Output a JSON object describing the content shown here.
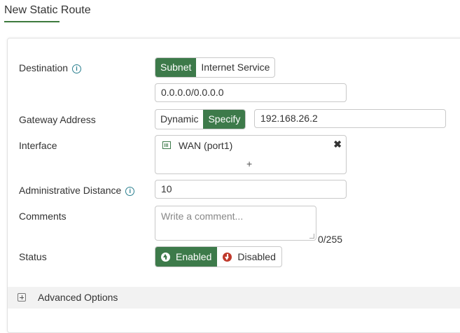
{
  "page": {
    "title": "New Static Route"
  },
  "form": {
    "destination": {
      "label": "Destination",
      "options": [
        "Subnet",
        "Internet Service"
      ],
      "selected": "Subnet",
      "value": "0.0.0.0/0.0.0.0"
    },
    "gateway": {
      "label": "Gateway Address",
      "options": [
        "Dynamic",
        "Specify"
      ],
      "selected": "Specify",
      "value": "192.168.26.2"
    },
    "interface": {
      "label": "Interface",
      "selected_item": "WAN (port1)",
      "add_label": "+",
      "remove_label": "✖"
    },
    "admin_distance": {
      "label": "Administrative Distance",
      "value": "10"
    },
    "comments": {
      "label": "Comments",
      "placeholder": "Write a comment...",
      "counter": "0/255"
    },
    "status": {
      "label": "Status",
      "options": [
        "Enabled",
        "Disabled"
      ],
      "selected": "Enabled"
    }
  },
  "advanced": {
    "label": "Advanced Options"
  },
  "colors": {
    "accent": "#3d7a4a",
    "info": "#2a7f8f",
    "danger": "#c0392b"
  },
  "icons": {
    "info": "info-icon",
    "interface": "network-port-icon",
    "remove": "close-icon",
    "enabled": "arrow-up-circle-icon",
    "disabled": "arrow-down-circle-icon",
    "expand": "plus-square-icon"
  }
}
